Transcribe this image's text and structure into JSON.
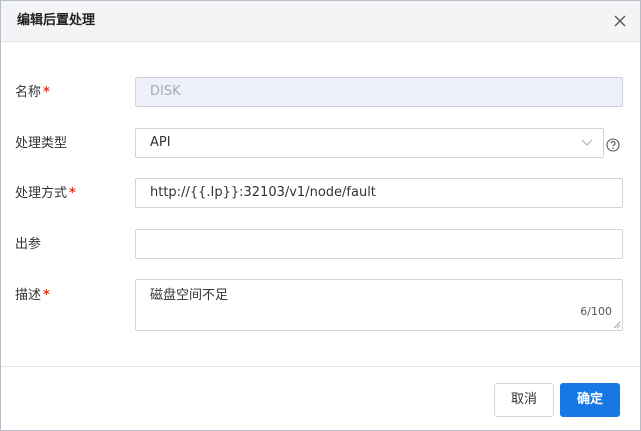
{
  "dialog": {
    "title": "编辑后置处理"
  },
  "form": {
    "name": {
      "label": "名称",
      "required_mark": "*",
      "value": "DISK"
    },
    "type": {
      "label": "处理类型",
      "value": "API"
    },
    "method": {
      "label": "处理方式",
      "required_mark": "*",
      "value": "http://{{.Ip}}:32103/v1/node/fault"
    },
    "output": {
      "label": "出参",
      "value": ""
    },
    "description": {
      "label": "描述",
      "required_mark": "*",
      "value": "磁盘空间不足",
      "counter": "6/100"
    }
  },
  "footer": {
    "cancel_label": "取消",
    "ok_label": "确定"
  },
  "colors": {
    "primary": "#1677e5",
    "required": "#e03a22",
    "header_bg": "#f3f4f6",
    "disabled_bg": "#eef1f7"
  },
  "icons": {
    "close": "close-icon",
    "select_arrow": "chevron-down-icon",
    "help": "help-circle-icon",
    "resize": "resize-grip-icon"
  }
}
